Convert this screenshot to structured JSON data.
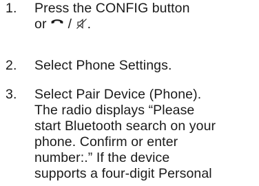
{
  "icons": {
    "phone": "phone-icon",
    "mute": "mute-icon"
  },
  "steps": [
    {
      "number": "1.",
      "lines": [
        "Press the CONFIG button"
      ],
      "line2_prefix": "or ",
      "line2_separator": " / ",
      "line2_suffix": "."
    },
    {
      "number": "2.",
      "lines": [
        "Select Phone Settings."
      ]
    },
    {
      "number": "3.",
      "lines": [
        "Select Pair Device (Phone).",
        "The radio displays “Please",
        "start Bluetooth search on your",
        "phone. Confirm or enter",
        "number:.” If the device",
        "supports a four-digit Personal"
      ]
    }
  ]
}
